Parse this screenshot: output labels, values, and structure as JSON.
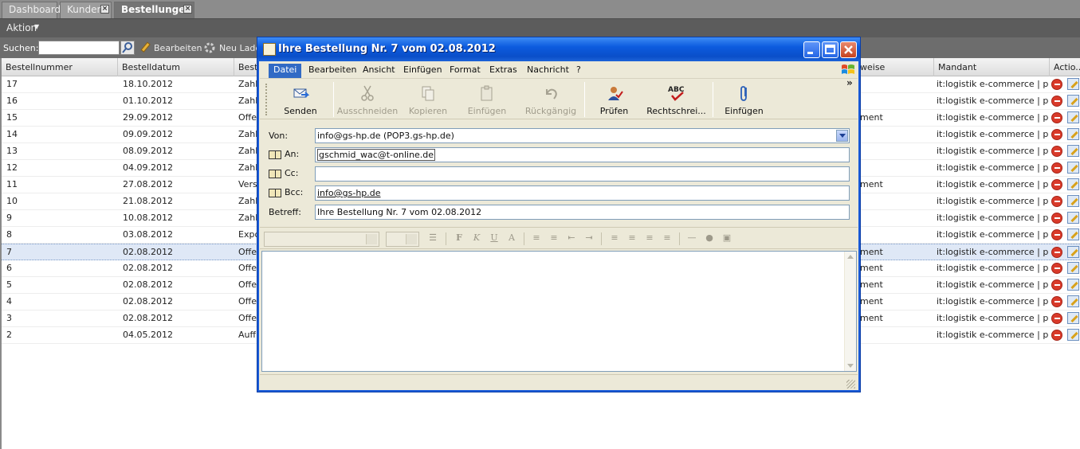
{
  "tabs": [
    {
      "label": "Dashboard",
      "closable": false,
      "active": false
    },
    {
      "label": "Kunden",
      "closable": true,
      "active": false
    },
    {
      "label": "Bestellungen",
      "closable": true,
      "active": true
    }
  ],
  "actionbar": {
    "aktion_label": "Aktion"
  },
  "toolbar": {
    "search_label": "Suchen:",
    "search_value": "",
    "edit_label": "Bearbeiten",
    "reload_label": "Neu Laden"
  },
  "grid": {
    "columns": [
      "Bestellnummer",
      "Bestelldatum",
      "Best",
      "weise",
      "Mandant",
      "Actio..."
    ],
    "rows": [
      {
        "nr": "17",
        "date": "18.10.2012",
        "status": "Zahl",
        "pay": "",
        "mandant": "it:logistik e-commerce | plu..."
      },
      {
        "nr": "16",
        "date": "01.10.2012",
        "status": "Zahl",
        "pay": "",
        "mandant": "it:logistik e-commerce | plu..."
      },
      {
        "nr": "15",
        "date": "29.09.2012",
        "status": "Offe",
        "pay": "ment",
        "mandant": "it:logistik e-commerce | plu..."
      },
      {
        "nr": "14",
        "date": "09.09.2012",
        "status": "Zahl",
        "pay": "",
        "mandant": "it:logistik e-commerce | plu..."
      },
      {
        "nr": "13",
        "date": "08.09.2012",
        "status": "Zahl",
        "pay": "",
        "mandant": "it:logistik e-commerce | plu..."
      },
      {
        "nr": "12",
        "date": "04.09.2012",
        "status": "Zahl",
        "pay": "",
        "mandant": "it:logistik e-commerce | plu..."
      },
      {
        "nr": "11",
        "date": "27.08.2012",
        "status": "Vers",
        "pay": "ment",
        "mandant": "it:logistik e-commerce | plu..."
      },
      {
        "nr": "10",
        "date": "21.08.2012",
        "status": "Zahl",
        "pay": "",
        "mandant": "it:logistik e-commerce | plu..."
      },
      {
        "nr": "9",
        "date": "10.08.2012",
        "status": "Zahl",
        "pay": "",
        "mandant": "it:logistik e-commerce | plu..."
      },
      {
        "nr": "8",
        "date": "03.08.2012",
        "status": "Expo",
        "pay": "",
        "mandant": "it:logistik e-commerce | plu..."
      },
      {
        "nr": "7",
        "date": "02.08.2012",
        "status": "Offe",
        "pay": "ment",
        "mandant": "it:logistik e-commerce | plu...",
        "selected": true
      },
      {
        "nr": "6",
        "date": "02.08.2012",
        "status": "Offe",
        "pay": "ment",
        "mandant": "it:logistik e-commerce | plu..."
      },
      {
        "nr": "5",
        "date": "02.08.2012",
        "status": "Offe",
        "pay": "ment",
        "mandant": "it:logistik e-commerce | plu..."
      },
      {
        "nr": "4",
        "date": "02.08.2012",
        "status": "Offe",
        "pay": "ment",
        "mandant": "it:logistik e-commerce | plu..."
      },
      {
        "nr": "3",
        "date": "02.08.2012",
        "status": "Offe",
        "pay": "ment",
        "mandant": "it:logistik e-commerce | plu..."
      },
      {
        "nr": "2",
        "date": "04.05.2012",
        "status": "Auff",
        "pay": "",
        "mandant": "it:logistik e-commerce | plu..."
      }
    ]
  },
  "email_window": {
    "title": "Ihre Bestellung Nr. 7 vom 02.08.2012",
    "menu": [
      "Datei",
      "Bearbeiten",
      "Ansicht",
      "Einfügen",
      "Format",
      "Extras",
      "Nachricht",
      "?"
    ],
    "toolbar": [
      {
        "label": "Senden",
        "icon": "send-icon",
        "enabled": true
      },
      {
        "label": "Ausschneiden",
        "icon": "cut-icon",
        "enabled": false
      },
      {
        "label": "Kopieren",
        "icon": "copy-icon",
        "enabled": false
      },
      {
        "label": "Einfügen",
        "icon": "paste-icon",
        "enabled": false
      },
      {
        "label": "Rückgängig",
        "icon": "undo-icon",
        "enabled": false
      },
      {
        "label": "Prüfen",
        "icon": "check-names-icon",
        "enabled": true
      },
      {
        "label": "Rechtschrei...",
        "icon": "spelling-icon",
        "enabled": true
      },
      {
        "label": "Einfügen",
        "icon": "attach-icon",
        "enabled": true
      }
    ],
    "overflow_label": "»",
    "fields": {
      "from_label": "Von:",
      "from_value": "info@gs-hp.de    (POP3.gs-hp.de)",
      "to_label": "An:",
      "to_value": "gschmid_wac@t-online.de",
      "cc_label": "Cc:",
      "cc_value": "",
      "bcc_label": "Bcc:",
      "bcc_value": "info@gs-hp.de",
      "subject_label": "Betreff:",
      "subject_value": "Ihre Bestellung Nr. 7 vom 02.08.2012"
    },
    "body": ""
  },
  "colors": {
    "titlebar": "#0a4fc9",
    "menu_active": "#316ac5",
    "selected_row": "#dfe8f6",
    "app_chrome": "#6d6d6d"
  }
}
